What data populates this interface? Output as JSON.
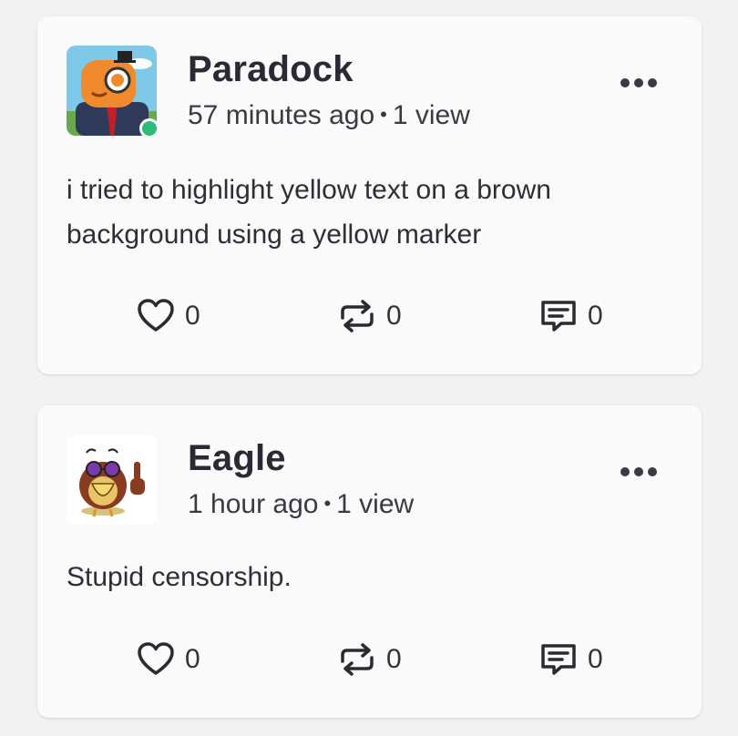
{
  "posts": [
    {
      "username": "Paradock",
      "time": "57 minutes ago",
      "views": "1 view",
      "online": true,
      "text": "i tried to highlight yellow text on a brown background using a yellow marker",
      "likes": "0",
      "reposts": "0",
      "comments": "0"
    },
    {
      "username": "Eagle",
      "time": "1 hour ago",
      "views": "1 view",
      "online": false,
      "text": "Stupid censorship.",
      "likes": "0",
      "reposts": "0",
      "comments": "0"
    }
  ],
  "separator": "•",
  "icons": {
    "more": "more-dots-icon",
    "like": "heart-icon",
    "repost": "repost-icon",
    "comment": "comment-icon"
  },
  "colors": {
    "background": "#f2f2f2",
    "card": "#fafafa",
    "online": "#2dbb7a",
    "text": "#2b2b33"
  }
}
